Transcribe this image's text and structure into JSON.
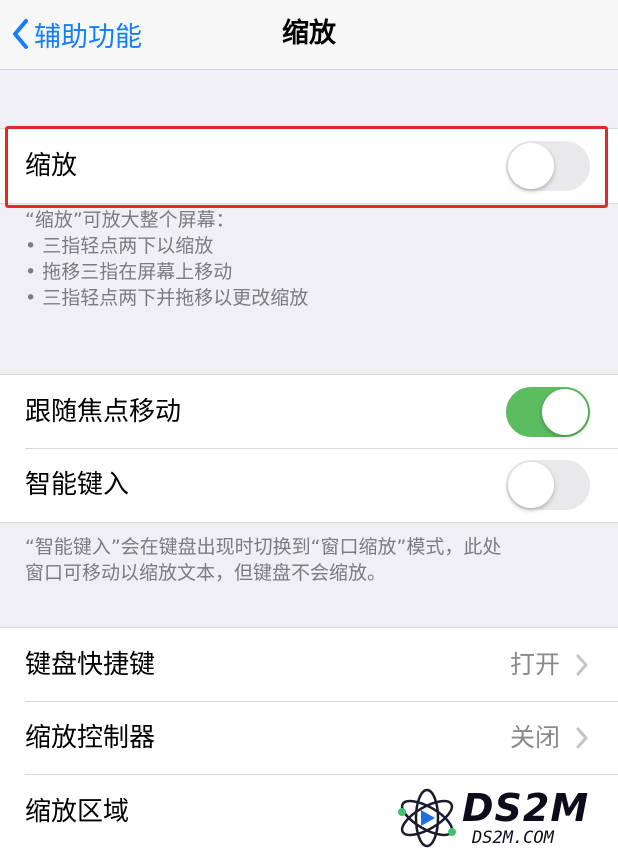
{
  "nav": {
    "back_label": "辅助功能",
    "title": "缩放"
  },
  "zoom_group": {
    "zoom_label": "缩放",
    "zoom_on": false
  },
  "zoom_footer": {
    "intro": "“缩放”可放大整个屏幕：",
    "bullets": [
      "• 三指轻点两下以缩放",
      "• 拖移三指在屏幕上移动",
      "• 三指轻点两下并拖移以更改缩放"
    ]
  },
  "focus_group": {
    "follow_focus_label": "跟随焦点移动",
    "follow_focus_on": true,
    "smart_typing_label": "智能键入",
    "smart_typing_on": false
  },
  "smart_typing_footer": {
    "line1": "“智能键入”会在键盘出现时切换到“窗口缩放”模式，此处",
    "line2": "窗口可移动以缩放文本，但键盘不会缩放。"
  },
  "nav_group": {
    "keyboard_shortcuts_label": "键盘快捷键",
    "keyboard_shortcuts_value": "打开",
    "zoom_controller_label": "缩放控制器",
    "zoom_controller_value": "关闭",
    "zoom_region_label": "缩放区域"
  },
  "watermark": {
    "brand": "DS2M",
    "url": "DS2M.COM"
  },
  "colors": {
    "accent": "#157efb",
    "toggle_on": "#5bbd60",
    "highlight": "#e32828"
  }
}
